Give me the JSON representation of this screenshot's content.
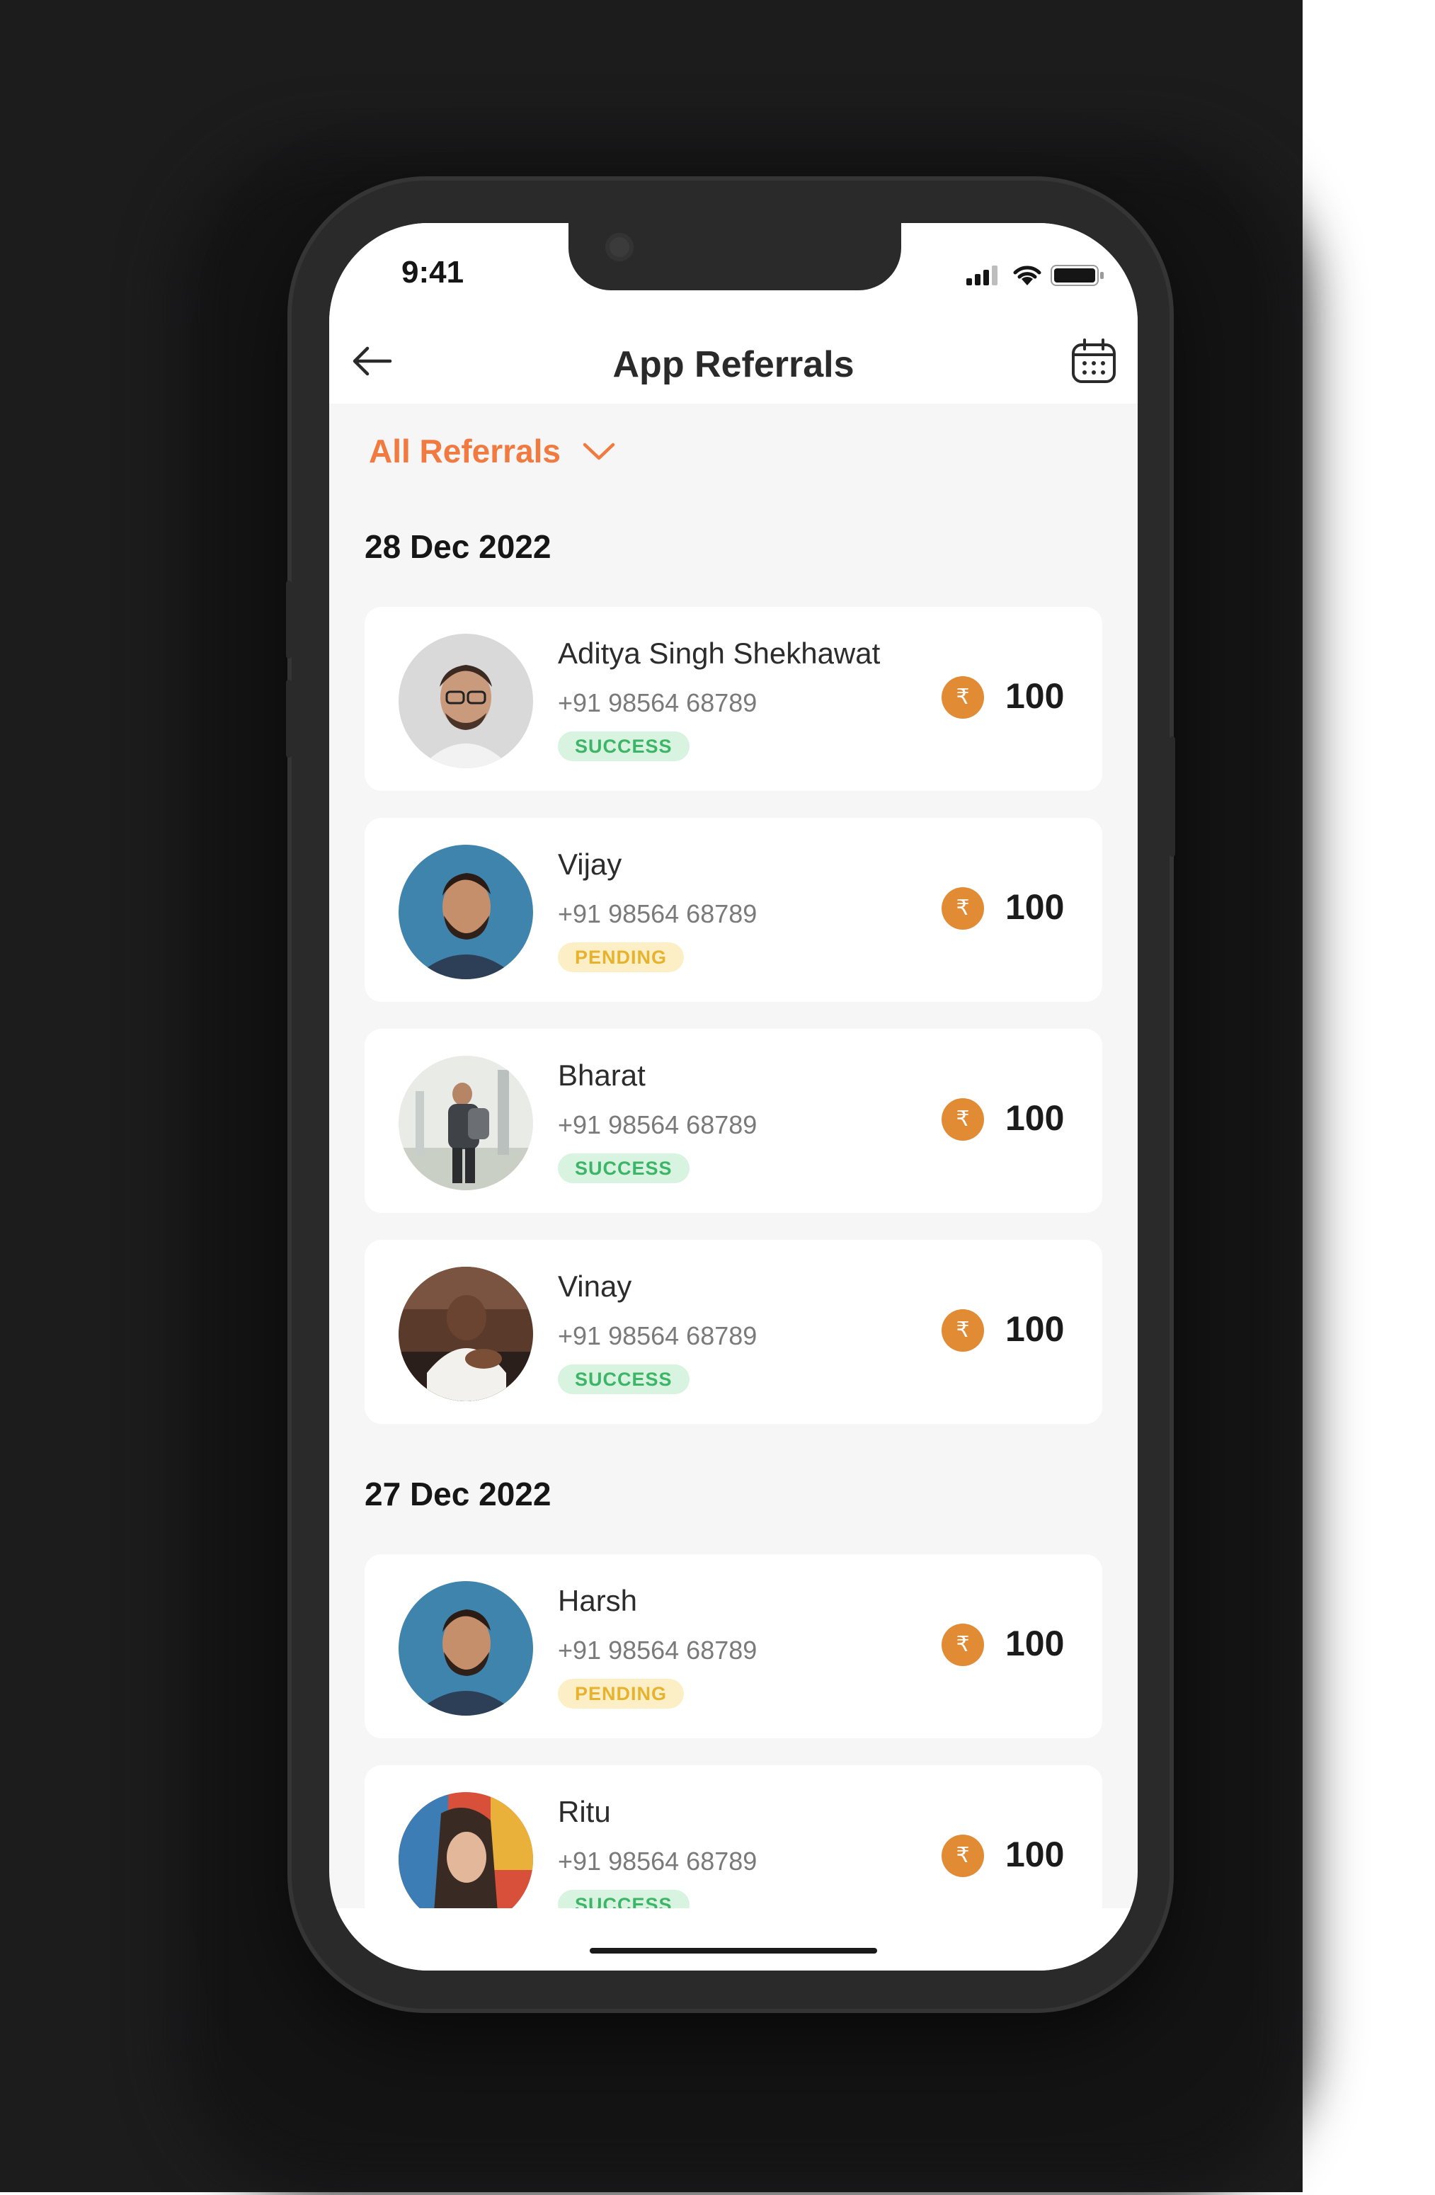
{
  "status_bar": {
    "time": "9:41"
  },
  "app_bar": {
    "title": "App Referrals"
  },
  "filter": {
    "label": "All Referrals"
  },
  "groups": [
    {
      "date": "28 Dec 2022",
      "items": [
        {
          "name": "Aditya Singh Shekhawat",
          "phone": "+91 98564 68789",
          "status": "SUCCESS",
          "amount": "100"
        },
        {
          "name": "Vijay",
          "phone": "+91 98564 68789",
          "status": "PENDING",
          "amount": "100"
        },
        {
          "name": "Bharat",
          "phone": "+91 98564 68789",
          "status": "SUCCESS",
          "amount": "100"
        },
        {
          "name": "Vinay",
          "phone": "+91 98564 68789",
          "status": "SUCCESS",
          "amount": "100"
        }
      ]
    },
    {
      "date": "27 Dec 2022",
      "items": [
        {
          "name": "Harsh",
          "phone": "+91 98564 68789",
          "status": "PENDING",
          "amount": "100"
        },
        {
          "name": "Ritu",
          "phone": "+91 98564 68789",
          "status": "SUCCESS",
          "amount": "100"
        }
      ]
    }
  ],
  "currency_symbol": "₹",
  "colors": {
    "accent": "#f07a3f",
    "success_bg": "#d8f3df",
    "success_text": "#3cb567",
    "pending_bg": "#fcefc6",
    "pending_text": "#e7b22f",
    "coin": "#e18b35"
  }
}
